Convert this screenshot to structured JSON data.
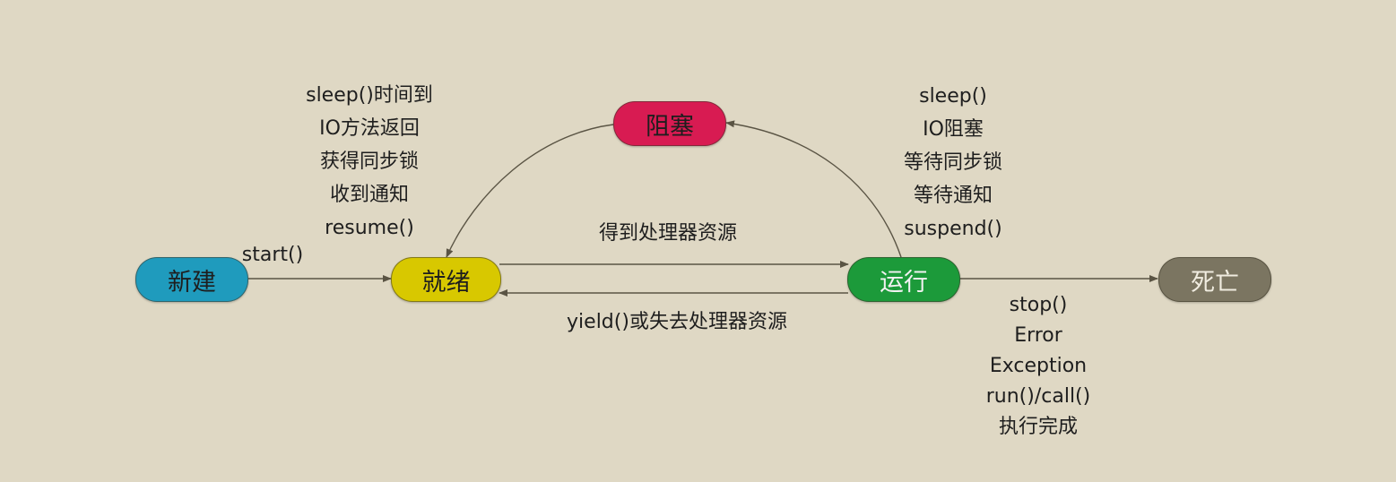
{
  "states": {
    "new": {
      "label": "新建",
      "color": "#1f9bbd"
    },
    "ready": {
      "label": "就绪",
      "color": "#d8c800"
    },
    "blocked": {
      "label": "阻塞",
      "color": "#d81b52"
    },
    "running": {
      "label": "运行",
      "color": "#1c9a3a"
    },
    "dead": {
      "label": "死亡",
      "color": "#7b7561"
    }
  },
  "transitions": {
    "new_to_ready": [
      "start()"
    ],
    "blocked_to_ready": [
      "sleep()时间到",
      "IO方法返回",
      "获得同步锁",
      "收到通知",
      "resume()"
    ],
    "running_to_blocked": [
      "sleep()",
      "IO阻塞",
      "等待同步锁",
      "等待通知",
      "suspend()"
    ],
    "ready_to_running": [
      "得到处理器资源"
    ],
    "running_to_ready": [
      "yield()或失去处理器资源"
    ],
    "running_to_dead": [
      "stop()",
      "Error",
      "Exception",
      "run()/call()",
      "执行完成"
    ]
  },
  "colors": {
    "edge": "#5a5444",
    "background": "#dfd8c4"
  }
}
